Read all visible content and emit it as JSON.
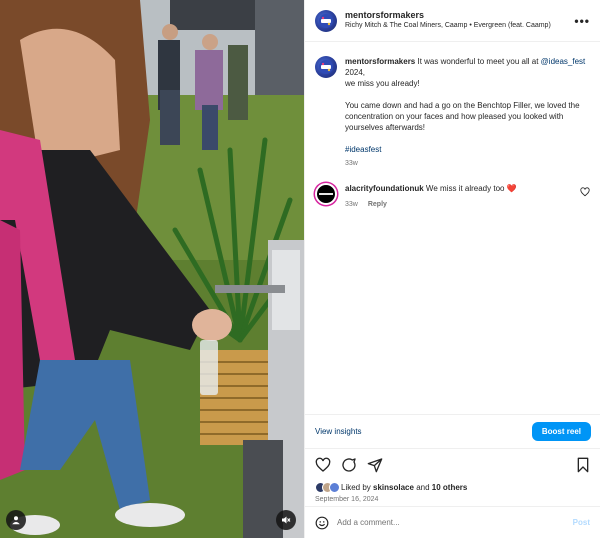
{
  "header": {
    "username": "mentorsformakers",
    "audio": "Richy Mitch & The Coal Miners, Caamp • Evergreen (feat. Caamp)",
    "more_label": "•••"
  },
  "caption": {
    "username": "mentorsformakers",
    "line1_prefix": "It was wonderful to meet you all at",
    "mention": "@ideas_fest",
    "line1_suffix": "2024,",
    "line2": "we miss you already!",
    "paragraph": "You came down and had a go on the Benchtop Filler, we loved the concentration on your faces and how pleased you looked with yourselves afterwards!",
    "hashtag": "#ideasfest",
    "time": "33w"
  },
  "comment": {
    "username": "alacrityfoundationuk",
    "text": "We miss it already too",
    "emoji": "❤️",
    "time": "33w",
    "reply_label": "Reply"
  },
  "insights": {
    "view_label": "View insights",
    "boost_label": "Boost reel"
  },
  "likes": {
    "prefix": "Liked by",
    "user": "skinsolace",
    "conj": "and",
    "others": "10 others"
  },
  "date": "September 16, 2024",
  "add_comment": {
    "placeholder": "Add a comment...",
    "post_label": "Post"
  },
  "colors": {
    "link": "#00376b",
    "boost": "#0095f6",
    "post_disabled": "#b3dbff",
    "heart": "#ed4956"
  },
  "icons": [
    "heart-icon",
    "comment-icon",
    "share-icon",
    "bookmark-icon",
    "emoji-icon",
    "user-tag-icon",
    "mute-icon",
    "more-icon"
  ]
}
